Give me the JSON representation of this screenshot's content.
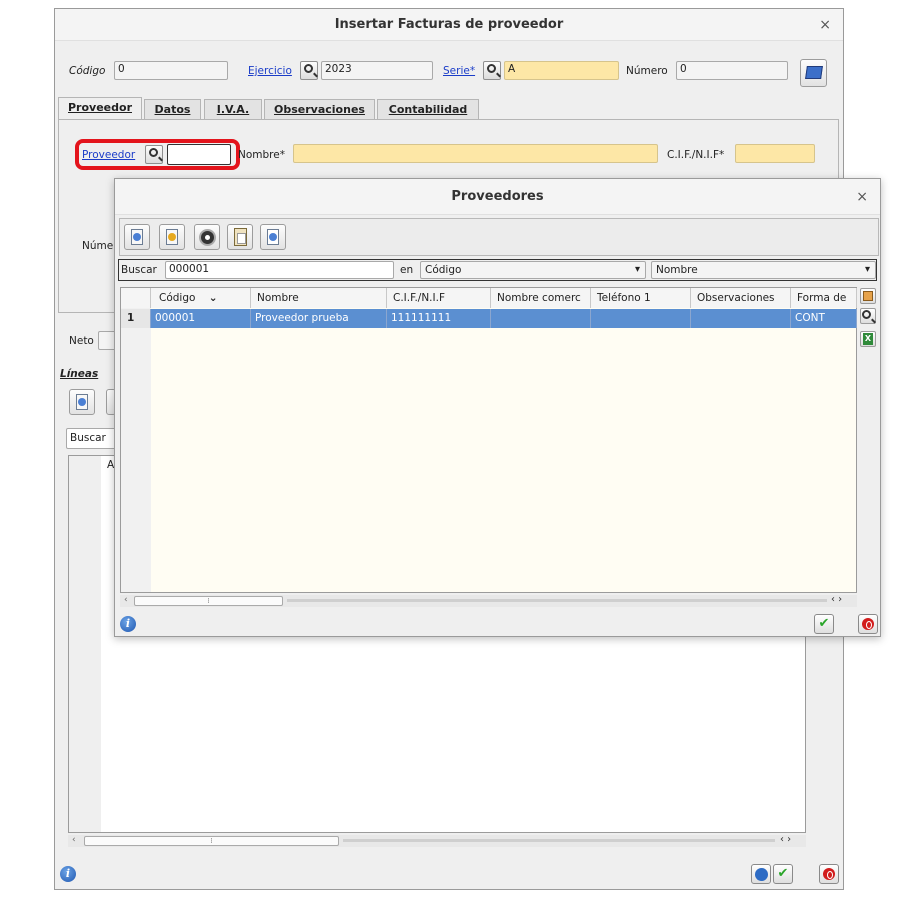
{
  "main_window": {
    "title": "Insertar Facturas de proveedor",
    "close": "×",
    "codigo_label": "Código",
    "codigo_value": "0",
    "ejercicio_label": "Ejercicio",
    "ejercicio_value": "2023",
    "serie_label": "Serie*",
    "serie_value": "A",
    "numero_label": "Número",
    "numero_value": "0",
    "tabs": [
      {
        "label": "Proveedor"
      },
      {
        "label": "Datos"
      },
      {
        "label": "I.V.A."
      },
      {
        "label": "Observaciones"
      },
      {
        "label": "Contabilidad"
      }
    ],
    "proveedor_label": "Proveedor",
    "proveedor_value": "",
    "nombre_label": "Nombre*",
    "nombre_value": "",
    "cif_label": "C.I.F./N.I.F*",
    "cif_value": "",
    "numero_partial_label": "Núme",
    "neto_label": "Neto",
    "lineas_label": "Líneas",
    "buscar_label": "Buscar",
    "grid_partial_header": "A"
  },
  "dialog": {
    "title": "Proveedores",
    "close": "×",
    "buscar_label": "Buscar",
    "buscar_value": "000001",
    "en_label": "en",
    "field_select": "Código",
    "order_select": "Nombre",
    "columns": [
      "Código",
      "Nombre",
      "C.I.F./N.I.F",
      "Nombre comerc",
      "Teléfono 1",
      "Observaciones",
      "Forma de"
    ],
    "sort_indicator": "⌄",
    "rows": [
      {
        "index": "1",
        "codigo": "000001",
        "nombre": "Proveedor prueba",
        "cif": "111111111",
        "nombre_comercial": "",
        "telefono": "",
        "observaciones": "",
        "forma_pago": "CONT"
      }
    ]
  },
  "colors": {
    "required_field": "#fde7a6",
    "selected_row": "#5b8fd1",
    "highlight_outline": "#e3141c",
    "link": "#1a3cc8"
  },
  "icons": [
    "search-icon",
    "new-record-icon",
    "edit-record-icon",
    "delete-record-icon",
    "copy-record-icon",
    "browse-record-icon",
    "info-icon",
    "accept-icon",
    "cancel-icon",
    "refresh-icon",
    "excel-icon",
    "config-grid-icon"
  ]
}
